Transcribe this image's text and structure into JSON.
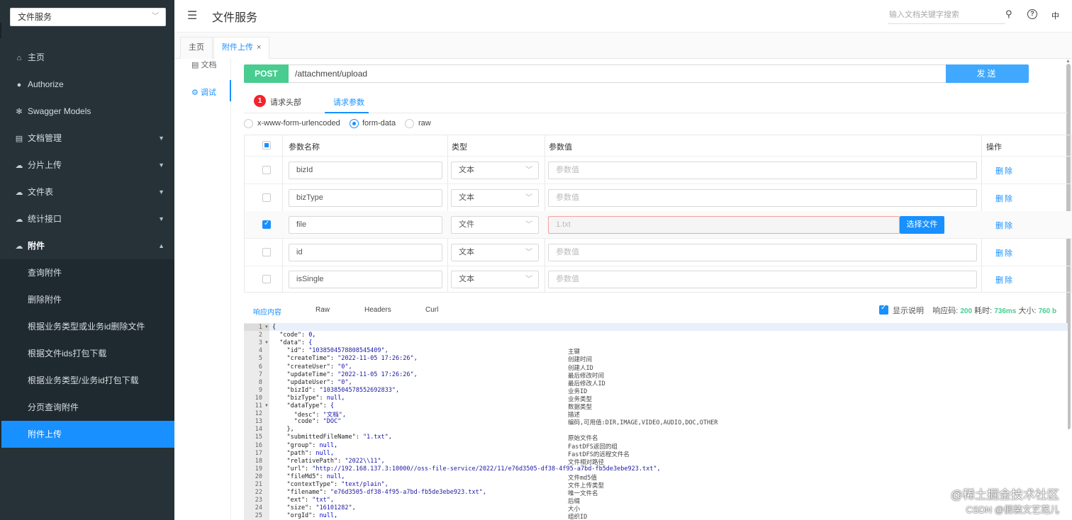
{
  "sidebar": {
    "doc_select": "文件服务",
    "items": [
      {
        "label": "主页",
        "icon": "home-icon"
      },
      {
        "label": "Authorize",
        "icon": "lock-icon"
      },
      {
        "label": "Swagger Models",
        "icon": "gear-icon"
      },
      {
        "label": "文档管理",
        "icon": "document-icon"
      },
      {
        "label": "分片上传",
        "icon": "cloud-icon"
      },
      {
        "label": "文件表",
        "icon": "cloud-icon"
      },
      {
        "label": "统计接口",
        "icon": "cloud-icon"
      },
      {
        "label": "附件",
        "icon": "cloud-icon"
      }
    ],
    "sub_items": [
      "查询附件",
      "删除附件",
      "根据业务类型或业务id删除文件",
      "根据文件ids打包下载",
      "根据业务类型/业务id打包下载",
      "分页查询附件",
      "附件上传"
    ]
  },
  "header": {
    "title": "文件服务",
    "search_placeholder": "输入文档关键字搜索",
    "lang": "中"
  },
  "tabs": [
    {
      "label": "主页"
    },
    {
      "label": "附件上传",
      "close": "×"
    }
  ],
  "subnav": {
    "doc": "文档",
    "debug": "调试"
  },
  "request": {
    "method": "POST",
    "url": "/attachment/upload",
    "send": "发送"
  },
  "req_tabs": {
    "headers": "请求头部",
    "headers_badge": "1",
    "params": "请求参数"
  },
  "content_types": [
    "x-www-form-urlencoded",
    "form-data",
    "raw"
  ],
  "param_table": {
    "headers": [
      "参数名称",
      "类型",
      "参数值",
      "操作"
    ],
    "rows": [
      {
        "name": "bizId",
        "type": "文本",
        "value": "参数值",
        "checked": false
      },
      {
        "name": "bizType",
        "type": "文本",
        "value": "参数值",
        "checked": false
      },
      {
        "name": "file",
        "type": "文件",
        "value": "1.txt",
        "checked": true
      },
      {
        "name": "id",
        "type": "文本",
        "value": "参数值",
        "checked": false
      },
      {
        "name": "isSingle",
        "type": "文本",
        "value": "参数值",
        "checked": false
      }
    ],
    "delete_label": "删除",
    "choose_file": "选择文件"
  },
  "response": {
    "tabs": [
      "响应内容",
      "Raw",
      "Headers",
      "Curl"
    ],
    "show_desc": "显示说明",
    "code_label": "响应码:",
    "code": "200",
    "time_label": "耗时:",
    "time": "736ms",
    "size_label": "大小:",
    "size": "760 b"
  },
  "code_lines": [
    {
      "n": "1",
      "fold": true,
      "text": "{",
      "c": ""
    },
    {
      "n": "2",
      "fold": false,
      "text": "  \"code\": 0,",
      "c": ""
    },
    {
      "n": "3",
      "fold": true,
      "text": "  \"data\": {",
      "c": ""
    },
    {
      "n": "4",
      "fold": false,
      "text": "    \"id\": \"1038504578808545409\",",
      "c": "主键"
    },
    {
      "n": "5",
      "fold": false,
      "text": "    \"createTime\": \"2022-11-05 17:26:26\",",
      "c": "创建时间"
    },
    {
      "n": "6",
      "fold": false,
      "text": "    \"createUser\": \"0\",",
      "c": "创建人ID"
    },
    {
      "n": "7",
      "fold": false,
      "text": "    \"updateTime\": \"2022-11-05 17:26:26\",",
      "c": "最后修改时间"
    },
    {
      "n": "8",
      "fold": false,
      "text": "    \"updateUser\": \"0\",",
      "c": "最后修改人ID"
    },
    {
      "n": "9",
      "fold": false,
      "text": "    \"bizId\": \"1038504578552692833\",",
      "c": "业务ID"
    },
    {
      "n": "10",
      "fold": false,
      "text": "    \"bizType\": null,",
      "c": "业务类型"
    },
    {
      "n": "11",
      "fold": true,
      "text": "    \"dataType\": {",
      "c": "数据类型"
    },
    {
      "n": "12",
      "fold": false,
      "text": "      \"desc\": \"文档\",",
      "c": "描述"
    },
    {
      "n": "13",
      "fold": false,
      "text": "      \"code\": \"DOC\"",
      "c": "编码,可用值:DIR,IMAGE,VIDEO,AUDIO,DOC,OTHER"
    },
    {
      "n": "14",
      "fold": false,
      "text": "    },",
      "c": ""
    },
    {
      "n": "15",
      "fold": false,
      "text": "    \"submittedFileName\": \"1.txt\",",
      "c": "原始文件名"
    },
    {
      "n": "16",
      "fold": false,
      "text": "    \"group\": null,",
      "c": "FastDFS返回的组"
    },
    {
      "n": "17",
      "fold": false,
      "text": "    \"path\": null,",
      "c": "FastDFS的远程文件名"
    },
    {
      "n": "18",
      "fold": false,
      "text": "    \"relativePath\": \"2022\\\\11\",",
      "c": "文件相对路径"
    },
    {
      "n": "19",
      "fold": false,
      "text": "    \"url\": \"http://192.168.137.3:10000//oss-file-service/2022/11/e76d3505-df38-4f95-a7bd-fb5de3ebe923.txt\",",
      "c": ""
    },
    {
      "n": "20",
      "fold": false,
      "text": "    \"fileMd5\": null,",
      "c": "文件md5值"
    },
    {
      "n": "21",
      "fold": false,
      "text": "    \"contextType\": \"text/plain\",",
      "c": "文件上传类型"
    },
    {
      "n": "22",
      "fold": false,
      "text": "    \"filename\": \"e76d3505-df38-4f95-a7bd-fb5de3ebe923.txt\",",
      "c": "唯一文件名"
    },
    {
      "n": "23",
      "fold": false,
      "text": "    \"ext\": \"txt\",",
      "c": "后缀"
    },
    {
      "n": "24",
      "fold": false,
      "text": "    \"size\": \"16101282\",",
      "c": "大小"
    },
    {
      "n": "25",
      "fold": false,
      "text": "    \"orgId\": null,",
      "c": "组织ID"
    }
  ],
  "watermark": {
    "line1": "@稀土掘金技术社区",
    "line2": "CSDN @假装文艺范儿"
  },
  "colors": {
    "sidebar_bg": "#263238",
    "accent": "#1890ff",
    "post": "#49cc90",
    "badge": "#f5222d"
  }
}
